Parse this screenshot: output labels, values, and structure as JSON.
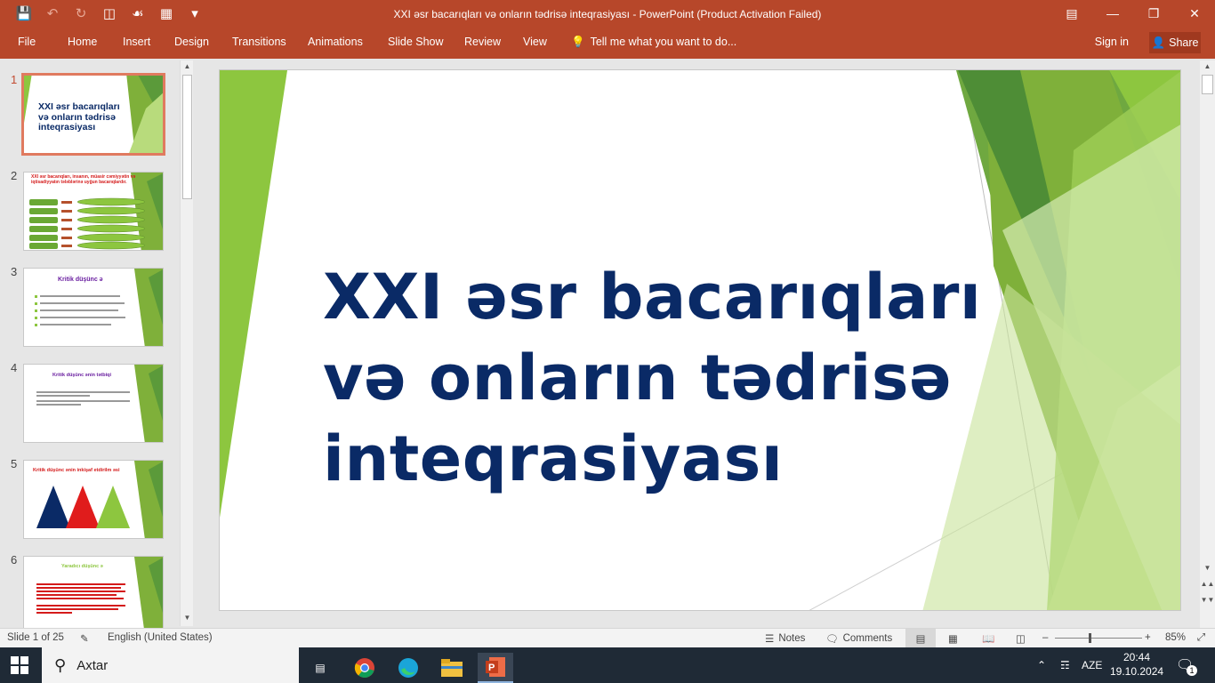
{
  "window": {
    "title": "XXI əsr bacarıqları və onların tədrisə inteqrasiyası - PowerPoint (Product Activation Failed)"
  },
  "ribbon": {
    "tabs": [
      "File",
      "Home",
      "Insert",
      "Design",
      "Transitions",
      "Animations",
      "Slide Show",
      "Review",
      "View"
    ],
    "tell_me": "Tell me what you want to do...",
    "sign_in": "Sign in",
    "share": "Share"
  },
  "thumbnails": [
    {
      "num": "1",
      "title": "XXI əsr bacarıqları və onların tədrisə inteqrasiyası"
    },
    {
      "num": "2",
      "title": "XXI əsr bacarıqları, insanın, müasir cəmiyyətin və iqtisadiyyatın tələblərinə uyğun bacarıqlardır."
    },
    {
      "num": "3",
      "title": "Kritik düşünc ə"
    },
    {
      "num": "4",
      "title": "Kritik düşünc ənin tətbiqi"
    },
    {
      "num": "5",
      "title": "Kritik düşünc ənin inkişaf etdirilm əsi"
    },
    {
      "num": "6",
      "title": "Yaradıcı düşünc ə"
    }
  ],
  "slide": {
    "title_line1": "XXI əsr bacarıqları",
    "title_line2": "və onların tədrisə",
    "title_line3": "inteqrasiyası"
  },
  "status": {
    "slide_info": "Slide 1 of 25",
    "language": "English (United States)",
    "notes": "Notes",
    "comments": "Comments",
    "zoom": "85%"
  },
  "taskbar": {
    "search_placeholder": "Axtar",
    "language": "AZE",
    "time": "20:44",
    "date": "19.10.2024",
    "notification_count": "1"
  },
  "colors": {
    "accent": "#b7472a",
    "title_text": "#0a2a66",
    "green_light": "#8dc63f",
    "green_dark": "#5b9a3a"
  }
}
